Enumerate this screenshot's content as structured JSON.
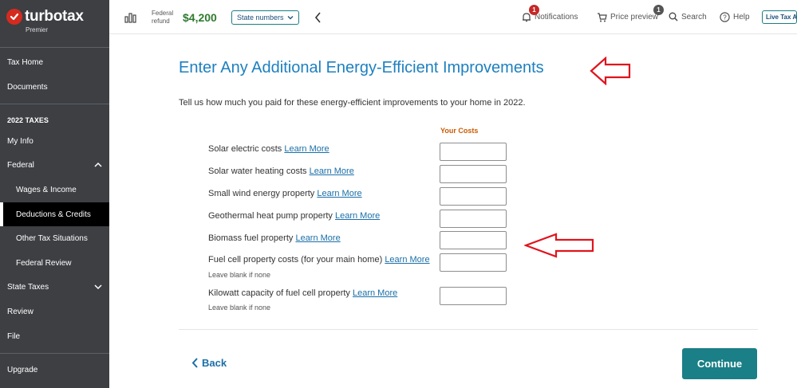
{
  "brand": {
    "name": "turbotax",
    "edition": "Premier"
  },
  "sidebar": {
    "tax_home": "Tax Home",
    "documents": "Documents",
    "section_title": "2022 TAXES",
    "my_info": "My Info",
    "federal": "Federal",
    "wages_income": "Wages & Income",
    "deductions_credits": "Deductions & Credits",
    "other_tax": "Other Tax Situations",
    "federal_review": "Federal Review",
    "state_taxes": "State Taxes",
    "review": "Review",
    "file": "File",
    "upgrade": "Upgrade"
  },
  "topbar": {
    "refund_label_1": "Federal",
    "refund_label_2": "refund",
    "refund_amount": "$4,200",
    "state_numbers": "State numbers",
    "notifications": "Notifications",
    "notifications_count": "1",
    "price_preview": "Price preview",
    "price_preview_count": "1",
    "search": "Search",
    "help": "Help",
    "live_tax": "Live Tax A"
  },
  "main": {
    "title": "Enter Any Additional Energy-Efficient Improvements",
    "intro": "Tell us how much you paid for these energy-efficient improvements to your home in 2022.",
    "column_header": "Your Costs",
    "learn_more": "Learn More",
    "leave_blank": "Leave blank if none",
    "rows": [
      {
        "label": "Solar electric costs",
        "value": ""
      },
      {
        "label": "Solar water heating costs",
        "value": ""
      },
      {
        "label": "Small wind energy property",
        "value": ""
      },
      {
        "label": "Geothermal heat pump property",
        "value": ""
      },
      {
        "label": "Biomass fuel property",
        "value": ""
      },
      {
        "label": "Fuel cell property costs (for your main home)",
        "value": ""
      },
      {
        "label": "Kilowatt capacity of fuel cell property",
        "value": ""
      }
    ],
    "back": "Back",
    "continue": "Continue"
  },
  "colors": {
    "sidebar_bg": "#3d3f43",
    "title_blue": "#1d80c0",
    "accent_teal": "#1a7f86",
    "refund_green": "#2f7a2f",
    "annotation_red": "#e0141e"
  },
  "icons": [
    "turbotax-check-icon",
    "chart-bars-icon",
    "chevron-down-icon",
    "chevron-left-icon",
    "bell-icon",
    "cart-icon",
    "search-icon",
    "help-icon",
    "chevron-up-icon",
    "red-annotation-arrow-icon"
  ]
}
